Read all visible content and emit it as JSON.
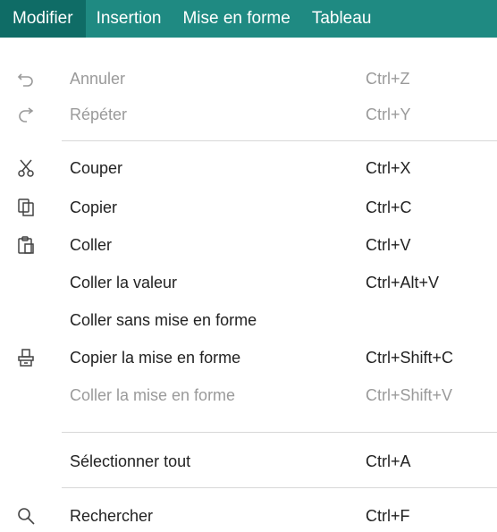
{
  "menubar": {
    "items": [
      {
        "label": "Modifier"
      },
      {
        "label": "Insertion"
      },
      {
        "label": "Mise en forme"
      },
      {
        "label": "Tableau"
      }
    ]
  },
  "menu": {
    "items": [
      {
        "label": "Annuler",
        "shortcut": "Ctrl+Z",
        "icon": "undo-icon",
        "enabled": false
      },
      {
        "label": "Répéter",
        "shortcut": "Ctrl+Y",
        "icon": "redo-icon",
        "enabled": false
      },
      {
        "label": "Couper",
        "shortcut": "Ctrl+X",
        "icon": "scissors-icon",
        "enabled": true
      },
      {
        "label": "Copier",
        "shortcut": "Ctrl+C",
        "icon": "copy-icon",
        "enabled": true
      },
      {
        "label": "Coller",
        "shortcut": "Ctrl+V",
        "icon": "paste-icon",
        "enabled": true
      },
      {
        "label": "Coller la valeur",
        "shortcut": "Ctrl+Alt+V",
        "icon": "",
        "enabled": true
      },
      {
        "label": "Coller sans mise en forme",
        "shortcut": "",
        "icon": "",
        "enabled": true
      },
      {
        "label": "Copier la mise en forme",
        "shortcut": "Ctrl+Shift+C",
        "icon": "format-painter-icon",
        "enabled": true
      },
      {
        "label": "Coller la mise en forme",
        "shortcut": "Ctrl+Shift+V",
        "icon": "",
        "enabled": false
      },
      {
        "label": "Sélectionner tout",
        "shortcut": "Ctrl+A",
        "icon": "",
        "enabled": true
      },
      {
        "label": "Rechercher",
        "shortcut": "Ctrl+F",
        "icon": "search-icon",
        "enabled": true
      }
    ]
  },
  "colors": {
    "menubar_bg": "#1f8a82",
    "menubar_active_bg": "#0f6c66",
    "text": "#222222",
    "disabled_text": "#9a9a9a"
  }
}
